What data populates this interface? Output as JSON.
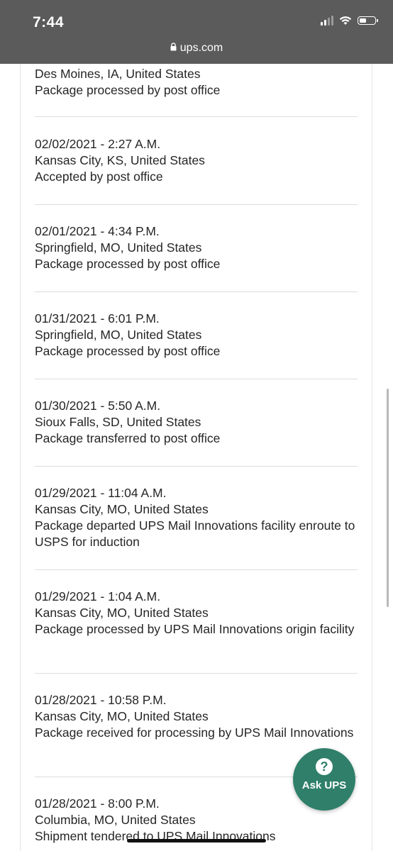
{
  "status_bar": {
    "time": "7:44",
    "url": "ups.com"
  },
  "colors": {
    "status_bar_bg": "#5b5b5b",
    "ask_ups_bg": "#2f7f6a"
  },
  "events": [
    {
      "date": "",
      "location": "Des Moines, IA, United States",
      "status": "Package processed by post office"
    },
    {
      "date": "02/02/2021 - 2:27 A.M.",
      "location": "Kansas City, KS, United States",
      "status": "Accepted by post office"
    },
    {
      "date": "02/01/2021 - 4:34 P.M.",
      "location": "Springfield, MO, United States",
      "status": "Package processed by post office"
    },
    {
      "date": "01/31/2021 - 6:01 P.M.",
      "location": "Springfield, MO, United States",
      "status": "Package processed by post office"
    },
    {
      "date": "01/30/2021 - 5:50 A.M.",
      "location": "Sioux Falls, SD, United States",
      "status": "Package transferred to post office"
    },
    {
      "date": "01/29/2021 - 11:04 A.M.",
      "location": "Kansas City, MO, United States",
      "status": "Package departed UPS Mail Innovations facility enroute to USPS for induction"
    },
    {
      "date": "01/29/2021 - 1:04 A.M.",
      "location": "Kansas City, MO, United States",
      "status": "Package processed by UPS Mail Innovations origin facility"
    },
    {
      "date": "01/28/2021 - 10:58 P.M.",
      "location": "Kansas City, MO, United States",
      "status": "Package received for processing by UPS Mail Innovations"
    },
    {
      "date": "01/28/2021 - 8:00 P.M.",
      "location": "Columbia, MO, United States",
      "status": "Shipment tendered to UPS Mail Innovations"
    }
  ],
  "ask_ups": {
    "label": "Ask UPS",
    "icon": "question-icon",
    "glyph": "?"
  }
}
